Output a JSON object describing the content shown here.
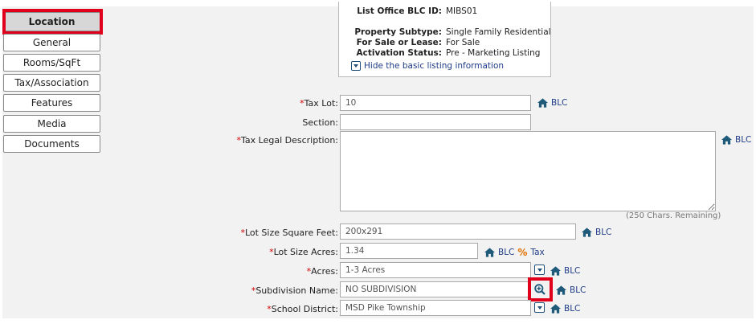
{
  "nav": {
    "items": [
      {
        "label": "Location",
        "active": true
      },
      {
        "label": "General"
      },
      {
        "label": "Rooms/SqFt"
      },
      {
        "label": "Tax/Association"
      },
      {
        "label": "Features"
      },
      {
        "label": "Media"
      },
      {
        "label": "Documents"
      }
    ]
  },
  "info": {
    "list_office_id_label": "List Office BLC ID:",
    "list_office_id_value": "MIBS01",
    "subtype_label": "Property Subtype:",
    "subtype_value": "Single Family Residential",
    "sale_lease_label": "For Sale or Lease:",
    "sale_lease_value": "For Sale",
    "activation_label": "Activation Status:",
    "activation_value": "Pre - Marketing Listing",
    "toggle_text": "Hide the basic listing information"
  },
  "form": {
    "required_mark": "*",
    "tax_lot": {
      "label": "Tax Lot:",
      "value": "10",
      "source": "BLC"
    },
    "section": {
      "label": "Section:",
      "value": ""
    },
    "tax_legal": {
      "label": "Tax Legal Description:",
      "value": "",
      "source": "BLC",
      "remaining": "(250 Chars. Remaining)"
    },
    "lot_sqft": {
      "label": "Lot Size Square Feet:",
      "value": "200x291",
      "source": "BLC"
    },
    "lot_acres": {
      "label": "Lot Size Acres:",
      "value": "1.34",
      "source": "BLC",
      "source2": "Tax"
    },
    "acres": {
      "label": "Acres:",
      "value": "1-3 Acres",
      "source": "BLC"
    },
    "subdivision": {
      "label": "Subdivision Name:",
      "value": "NO SUBDIVISION",
      "source": "BLC"
    },
    "school": {
      "label": "School District:",
      "value": "MSD Pike Township",
      "source": "BLC"
    }
  },
  "colors": {
    "highlight": "#e0001b",
    "link": "#1f3c88",
    "icon": "#1f5a7a"
  }
}
